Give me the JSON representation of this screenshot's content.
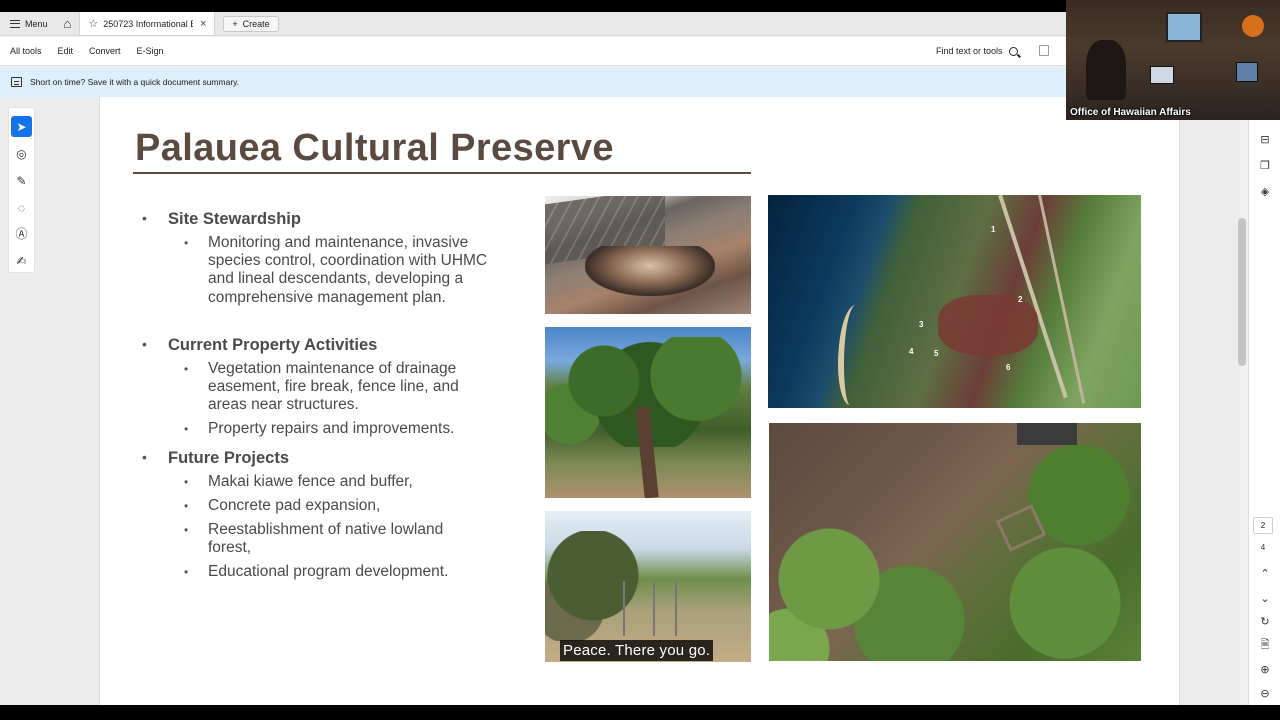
{
  "tabs": {
    "menu_label": "Menu",
    "doc_title": "250723 Informational Br...",
    "create_label": "Create"
  },
  "toolbar": {
    "items": [
      "All tools",
      "Edit",
      "Convert",
      "E-Sign"
    ],
    "find_label": "Find text or tools"
  },
  "banner": {
    "text": "Short on time? Save it with a quick document summary."
  },
  "slide": {
    "title": "Palauea Cultural Preserve",
    "sections": [
      {
        "heading": "Site Stewardship",
        "items": [
          "Monitoring and maintenance, invasive species control, coordination with UHMC and lineal descendants, developing a comprehensive management plan."
        ]
      },
      {
        "heading": "Current Property Activities",
        "items": [
          "Vegetation maintenance of drainage easement, fire break, fence line, and areas near structures.",
          "Property repairs and improvements."
        ]
      },
      {
        "heading": "Future Projects",
        "items": [
          "Makai kiawe fence and buffer,",
          "Concrete pad expansion,",
          "Reestablishment of native lowland forest,",
          "Educational program development."
        ]
      }
    ],
    "caption": "Peace. There you go.",
    "map_numbers": [
      "1",
      "2",
      "3",
      "4",
      "5",
      "6"
    ]
  },
  "webcam": {
    "label": "Office of Hawaiian Affairs"
  },
  "pager": {
    "current": "2",
    "total": "4"
  }
}
